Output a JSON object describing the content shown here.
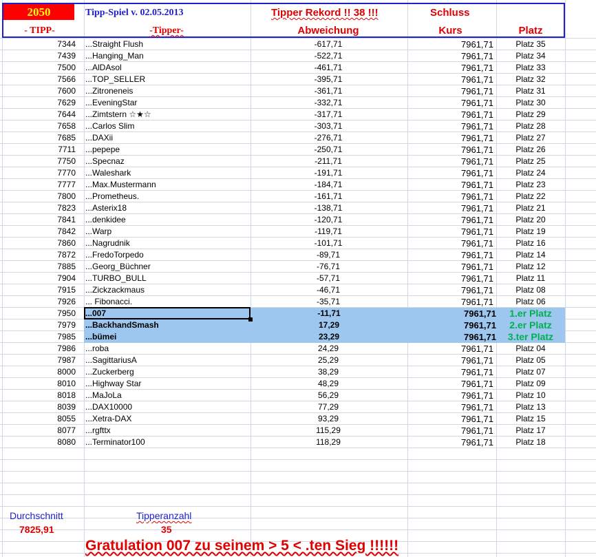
{
  "header": {
    "year": "2050",
    "title": "Tipp-Spiel v. 02.05.2013",
    "rekord_label": "Tipper Rekord !!  38  !!!",
    "schluss_label": "Schluss",
    "col_tipp": "- TIPP-",
    "col_tipper": "-Tipper-",
    "col_abweichung": "Abweichung",
    "col_kurs": "Kurs",
    "col_platz": "Platz"
  },
  "rows": [
    {
      "tipp": "7344",
      "name": "...Straight Flush",
      "abw": "-617,71",
      "kurs": "7961,71",
      "platz": "Platz 35"
    },
    {
      "tipp": "7439",
      "name": "...Hanging_Man",
      "abw": "-522,71",
      "kurs": "7961,71",
      "platz": "Platz 34"
    },
    {
      "tipp": "7500",
      "name": "...AlDAsol",
      "abw": "-461,71",
      "kurs": "7961,71",
      "platz": "Platz 33"
    },
    {
      "tipp": "7566",
      "name": "...TOP_SELLER",
      "abw": "-395,71",
      "kurs": "7961,71",
      "platz": "Platz 32"
    },
    {
      "tipp": "7600",
      "name": "...Zitroneneis",
      "abw": "-361,71",
      "kurs": "7961,71",
      "platz": "Platz 31"
    },
    {
      "tipp": "7629",
      "name": "...EveningStar",
      "abw": "-332,71",
      "kurs": "7961,71",
      "platz": "Platz 30"
    },
    {
      "tipp": "7644",
      "name": "...Zimtstern ☆★☆",
      "abw": "-317,71",
      "kurs": "7961,71",
      "platz": "Platz 29"
    },
    {
      "tipp": "7658",
      "name": "...Carlos Slim",
      "abw": "-303,71",
      "kurs": "7961,71",
      "platz": "Platz 28"
    },
    {
      "tipp": "7685",
      "name": "...DAXii",
      "abw": "-276,71",
      "kurs": "7961,71",
      "platz": "Platz 27"
    },
    {
      "tipp": "7711",
      "name": "...pepepe",
      "abw": "-250,71",
      "kurs": "7961,71",
      "platz": "Platz 26"
    },
    {
      "tipp": "7750",
      "name": "...Specnaz",
      "abw": "-211,71",
      "kurs": "7961,71",
      "platz": "Platz 25"
    },
    {
      "tipp": "7770",
      "name": "...Waleshark",
      "abw": "-191,71",
      "kurs": "7961,71",
      "platz": "Platz 24"
    },
    {
      "tipp": "7777",
      "name": "...Max.Mustermann",
      "abw": "-184,71",
      "kurs": "7961,71",
      "platz": "Platz 23"
    },
    {
      "tipp": "7800",
      "name": "...Prometheus.",
      "abw": "-161,71",
      "kurs": "7961,71",
      "platz": "Platz 22"
    },
    {
      "tipp": "7823",
      "name": "...Asterix18",
      "abw": "-138,71",
      "kurs": "7961,71",
      "platz": "Platz 21"
    },
    {
      "tipp": "7841",
      "name": "...denkidee",
      "abw": "-120,71",
      "kurs": "7961,71",
      "platz": "Platz 20"
    },
    {
      "tipp": "7842",
      "name": "...Warp",
      "abw": "-119,71",
      "kurs": "7961,71",
      "platz": "Platz 19"
    },
    {
      "tipp": "7860",
      "name": "...Nagrudnik",
      "abw": "-101,71",
      "kurs": "7961,71",
      "platz": "Platz 16"
    },
    {
      "tipp": "7872",
      "name": "...FredoTorpedo",
      "abw": "-89,71",
      "kurs": "7961,71",
      "platz": "Platz 14"
    },
    {
      "tipp": "7885",
      "name": "...Georg_Büchner",
      "abw": "-76,71",
      "kurs": "7961,71",
      "platz": "Platz 12"
    },
    {
      "tipp": "7904",
      "name": "...TURBO_BULL",
      "abw": "-57,71",
      "kurs": "7961,71",
      "platz": "Platz 11"
    },
    {
      "tipp": "7915",
      "name": "...Zickzackmaus",
      "abw": "-46,71",
      "kurs": "7961,71",
      "platz": "Platz 08"
    },
    {
      "tipp": "7926",
      "name": "... Fibonacci.",
      "abw": "-35,71",
      "kurs": "7961,71",
      "platz": "Platz 06"
    },
    {
      "tipp": "7950",
      "name": "...007",
      "abw": "-11,71",
      "kurs": "7961,71",
      "platz": "1.er Platz",
      "highlight": true
    },
    {
      "tipp": "7979",
      "name": "...BackhandSmash",
      "abw": "17,29",
      "kurs": "7961,71",
      "platz": "2.er Platz",
      "highlight": true
    },
    {
      "tipp": "7985",
      "name": "...bümei",
      "abw": "23,29",
      "kurs": "7961,71",
      "platz": "3.ter Platz",
      "highlight": true
    },
    {
      "tipp": "7986",
      "name": "...roba",
      "abw": "24,29",
      "kurs": "7961,71",
      "platz": "Platz 04"
    },
    {
      "tipp": "7987",
      "name": "...SagittariusA",
      "abw": "25,29",
      "kurs": "7961,71",
      "platz": "Platz 05"
    },
    {
      "tipp": "8000",
      "name": "...Zuckerberg",
      "abw": "38,29",
      "kurs": "7961,71",
      "platz": "Platz 07"
    },
    {
      "tipp": "8010",
      "name": "...Highway Star",
      "abw": "48,29",
      "kurs": "7961,71",
      "platz": "Platz 09"
    },
    {
      "tipp": "8018",
      "name": "...MaJoLa",
      "abw": "56,29",
      "kurs": "7961,71",
      "platz": "Platz 10"
    },
    {
      "tipp": "8039",
      "name": "...DAX10000",
      "abw": "77,29",
      "kurs": "7961,71",
      "platz": "Platz 13"
    },
    {
      "tipp": "8055",
      "name": "...Xetra-DAX",
      "abw": "93,29",
      "kurs": "7961,71",
      "platz": "Platz 15"
    },
    {
      "tipp": "8077",
      "name": "...rgfttx",
      "abw": "115,29",
      "kurs": "7961,71",
      "platz": "Platz 17"
    },
    {
      "tipp": "8080",
      "name": "...Terminator100",
      "abw": "118,29",
      "kurs": "7961,71",
      "platz": "Platz 18"
    }
  ],
  "footer": {
    "durchschnitt_label": "Durchschnitt",
    "durchschnitt_value": "7825,91",
    "tipperanzahl_label": "Tipperanzahl",
    "tipperanzahl_value": "35",
    "gratulation": "Gratulation   007  zu seinem > 5 < .ten Sieg !!!!!!"
  },
  "colors": {
    "header_blue": "#1f1fcc",
    "red": "#e00000",
    "year_bg": "#ff0000",
    "year_text": "#ffff00",
    "highlight_bg": "#9ec7f0",
    "winner_green": "#00b050",
    "grid": "#d0d7e5"
  }
}
